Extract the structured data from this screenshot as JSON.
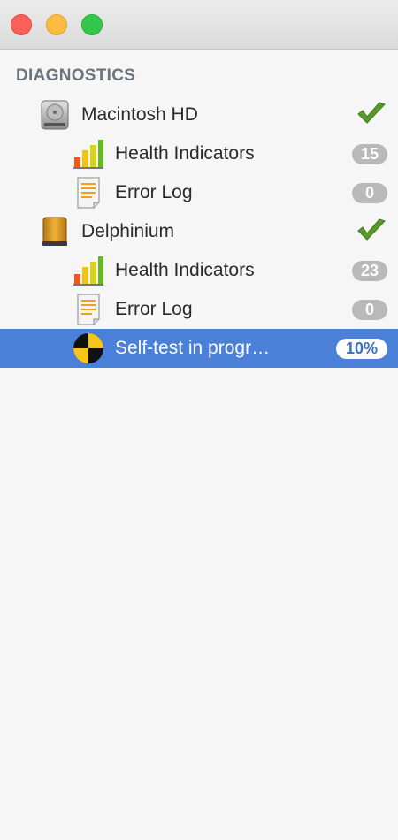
{
  "window": {
    "close_icon": "close-icon",
    "minimize_icon": "minimize-icon",
    "zoom_icon": "zoom-icon"
  },
  "sidebar": {
    "section_title": "DIAGNOSTICS",
    "disks": [
      {
        "name": "Macintosh HD",
        "icon": "internal-disk-icon",
        "status": "check-icon",
        "items": [
          {
            "label": "Health Indicators",
            "badge": "15",
            "icon": "health-chart-icon"
          },
          {
            "label": "Error Log",
            "badge": "0",
            "icon": "log-document-icon"
          }
        ]
      },
      {
        "name": "Delphinium",
        "icon": "external-disk-icon",
        "status": "check-icon",
        "items": [
          {
            "label": "Health Indicators",
            "badge": "23",
            "icon": "health-chart-icon"
          },
          {
            "label": "Error Log",
            "badge": "0",
            "icon": "log-document-icon"
          },
          {
            "label": "Self-test in progr…",
            "badge": "10%",
            "icon": "self-test-icon",
            "selected": true
          }
        ]
      }
    ]
  },
  "colors": {
    "selection": "#4a80d8",
    "badge": "#b9b9b9",
    "check": "#5a9a2a"
  }
}
